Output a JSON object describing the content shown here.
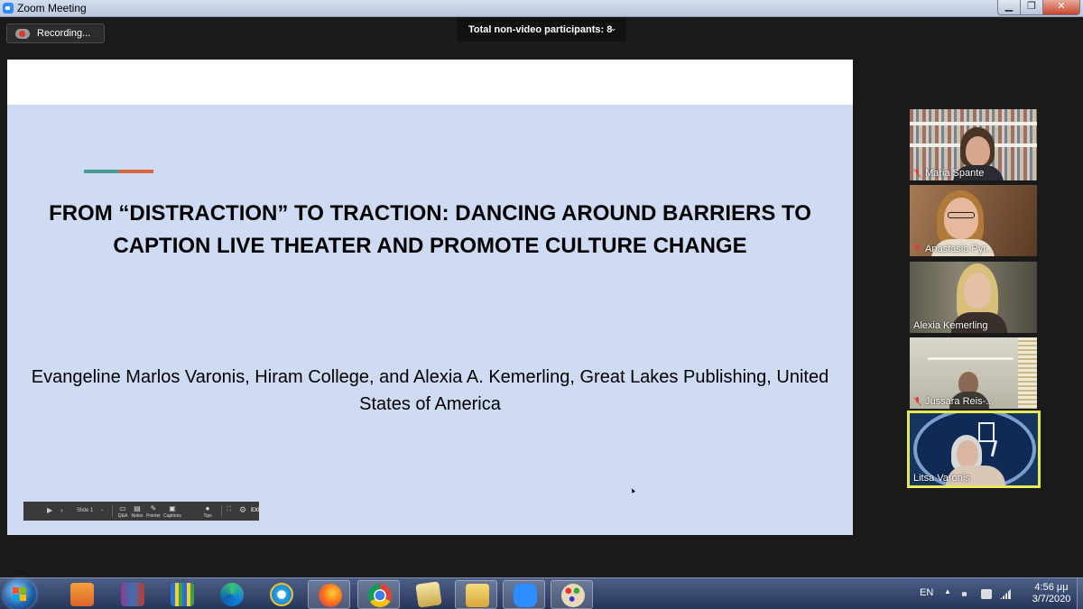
{
  "window": {
    "title": "Zoom Meeting",
    "controls": {
      "minimize": "▁",
      "maximize": "❐",
      "close": "✕"
    }
  },
  "recording": {
    "label": "Recording..."
  },
  "participants_banner": {
    "label": "Total non-video participants: 8",
    "chevron": "⌄"
  },
  "slide": {
    "title": "FROM “DISTRACTION” TO TRACTION: DANCING AROUND BARRIERS TO CAPTION LIVE THEATER AND PROMOTE CULTURE CHANGE",
    "authors": "Evangeline Marlos Varonis, Hiram College, and Alexia A. Kemerling, Great Lakes Publishing, United States of America",
    "accent_colors": [
      "#4a9a93",
      "#d9673d"
    ],
    "controls": {
      "play": "▶",
      "next": "›",
      "slide_label": "Slide 1",
      "slide_chevron": "⌄",
      "qa": "Q&A",
      "notes": "Notes",
      "pointer": "Pointer",
      "captions": "Captions",
      "tips": "Tips",
      "fullscreen": "⛶",
      "settings": "⚙",
      "exit": "EXIT"
    }
  },
  "video_tiles": [
    {
      "name": "Maria Spante",
      "muted": true
    },
    {
      "name": "Anastasia Pyr...",
      "muted": true
    },
    {
      "name": "Alexia Kemerling",
      "muted": false
    },
    {
      "name": "Jussara Reis-...",
      "muted": true
    },
    {
      "name": "Litsa Varonis",
      "muted": false,
      "active_speaker": true
    }
  ],
  "taskbar": {
    "language": "EN",
    "tray_up": "▲",
    "time": "4:56 μμ",
    "date": "3/7/2020",
    "apps": [
      "media-player",
      "winrar",
      "books",
      "edge",
      "internet-explorer",
      "firefox",
      "chrome",
      "image-viewer",
      "file-explorer",
      "zoom",
      "paint"
    ]
  }
}
